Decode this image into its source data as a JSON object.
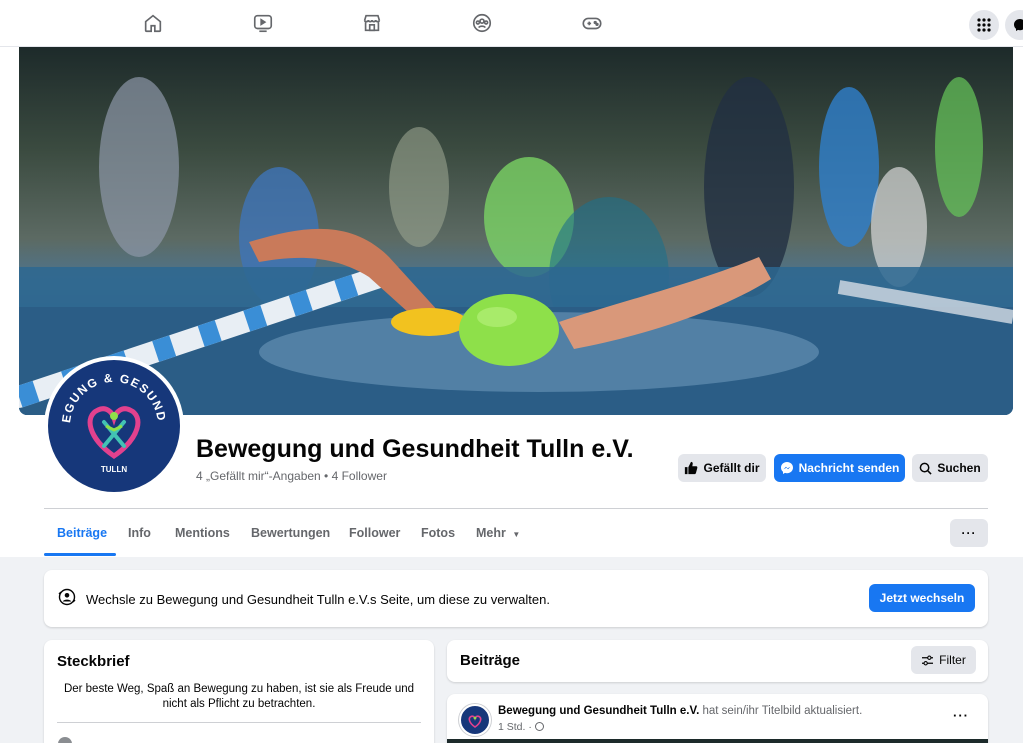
{
  "nav": {
    "icons": [
      "home-icon",
      "watch-icon",
      "marketplace-icon",
      "groups-icon",
      "gaming-icon"
    ]
  },
  "page": {
    "name": "Bewegung und Gesundheit Tulln e.V.",
    "stats": "4 „Gefällt mir“-Angaben • 4 Follower",
    "logo_top": "BEWEGUNG & GESUNDHEIT",
    "logo_bottom": "TULLN"
  },
  "actions": {
    "like": "Gefällt dir",
    "message": "Nachricht senden",
    "search": "Suchen"
  },
  "tabs": [
    "Beiträge",
    "Info",
    "Mentions",
    "Bewertungen",
    "Follower",
    "Fotos",
    "Mehr"
  ],
  "more_button": "···",
  "switch": {
    "text": "Wechsle zu Bewegung und Gesundheit Tulln e.V.s Seite, um diese zu verwalten.",
    "button": "Jetzt wechseln"
  },
  "intro": {
    "title": "Steckbrief",
    "bio": "Der beste Weg, Spaß an Bewegung zu haben, ist sie als Freude und nicht als Pflicht zu betrachten."
  },
  "posts": {
    "title": "Beiträge",
    "filter": "Filter",
    "post": {
      "author": "Bewegung und Gesundheit Tulln e.V.",
      "action": "hat sein/ihr Titelbild aktualisiert.",
      "time": "1 Std. ·",
      "menu": "···"
    }
  },
  "colors": {
    "accent": "#1877f2",
    "logo_bg": "#16377a",
    "cap": "#8ee04a"
  }
}
